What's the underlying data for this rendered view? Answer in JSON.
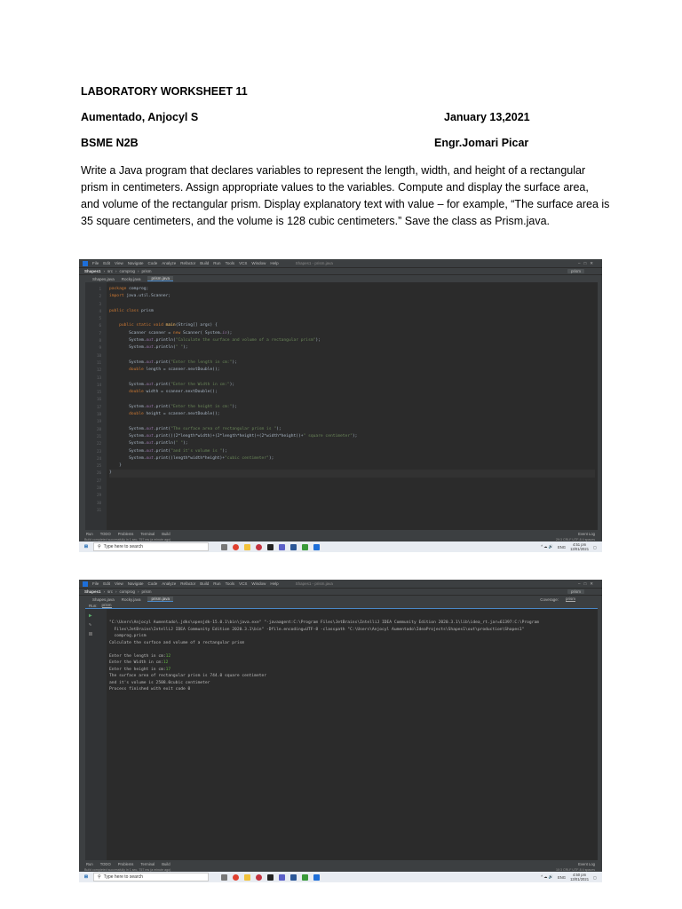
{
  "document": {
    "title": "LABORATORY WORKSHEET 11",
    "author": "Aumentado, Anjocyl S",
    "date": "January 13,2021",
    "section": "BSME N2B",
    "instructor": "Engr.Jomari Picar",
    "task": "Write a Java program that declares variables to represent the length, width, and height of a rectangular prism in centimeters. Assign appropriate values to the variables. Compute and display the surface area, and volume of the rectangular prism. Display explanatory text with value – for example, “The surface area is 35 square centimeters, and the volume is 128 cubic centimeters.” Save the class as Prism.java."
  },
  "ide": {
    "menu": [
      "File",
      "Edit",
      "View",
      "Navigate",
      "Code",
      "Analyze",
      "Refactor",
      "Build",
      "Run",
      "Tools",
      "VCS",
      "Window",
      "Help"
    ],
    "window_title": "Shapes1 - prism.java",
    "breadcrumb": [
      "Shapes1",
      "src",
      "comprog",
      "prism"
    ],
    "run_config": "prism",
    "tabs": [
      "Shapes.java",
      "Rocky.java",
      "prism.java"
    ],
    "bottom_tools": [
      "Run",
      "TODO",
      "Problems",
      "Terminal",
      "Build"
    ],
    "event_log": "Event Log",
    "status_message": "Build completed successfully in 1 sec, 757 ms (a minute ago)",
    "editor_position": "29:3  CRLF  UTF-8  4 spaces",
    "run_position": "10:3  CRLF  UTF-8  4 spaces",
    "run_tab_label": "Run:",
    "run_tab": "prism",
    "coverage_label": "Coverage:",
    "coverage_tab": "prism"
  },
  "code": {
    "line_numbers": "1\n2\n3\n4\n5\n6\n7\n8\n9\n10\n11\n12\n13\n14\n15\n16\n17\n18\n19\n20\n21\n22\n23\n24\n25\n26\n27\n28\n29\n30\n31",
    "l1": "package ",
    "l1b": "comprog;",
    "l2": "import ",
    "l2b": "java.util.Scanner;",
    "l4": "public class ",
    "l4b": "prism",
    "l6a": "    public static void ",
    "l6b": "main",
    "l6c": "(String[] args) {",
    "l7a": "        Scanner scanner = ",
    "l7b": "new ",
    "l7c": "Scanner( System.",
    "l7d": "in",
    "l7e": ");",
    "l8a": "        System.",
    "l8b": "out",
    "l8c": ".println(",
    "l8d": "\"Calculate the surface and volume of a rectangular prism\"",
    "l8e": ");",
    "l9d": "\" \"",
    "l11d": "\"Enter the length in cm:\"",
    "l12a": "        double ",
    "l12b": "length = scanner.nextDouble();",
    "l14d": "\"Enter the Width in cm:\"",
    "l15b": "width = scanner.nextDouble();",
    "l17d": "\"Enter the height in cm:\"",
    "l18b": "height = scanner.nextDouble();",
    "l20d": "\"The surface area of rectangular prism is \"",
    "l21c": ".print(((2*length*width)+(2*length*height)+(2*width*height))+",
    "l21d": "\" square centimeter\"",
    "l22d": "\" \"",
    "l23d": "\"and it's volume is \"",
    "l24c": ".print((length*width*height)+",
    "l24d": "\"cubic centimeter\"",
    "print": ".print(",
    "println": ".println(",
    "close_paren": ");",
    "close_brace_inner": "    }",
    "close_brace_outer": "}"
  },
  "console": {
    "command": "\"C:\\Users\\Anjocyl Aumentado\\.jdks\\openjdk-15.0.1\\bin\\java.exe\" \"-javaagent:C:\\Program Files\\JetBrains\\IntelliJ IDEA Community Edition 2020.3.1\\lib\\idea_rt.jar=61397:C:\\Program",
    "command2": "  Files\\JetBrains\\IntelliJ IDEA Community Edition 2020.3.1\\bin\" -Dfile.encoding=UTF-8 -classpath \"C:\\Users\\Anjocyl Aumentado\\IdeaProjects\\Shapes1\\out\\production\\Shapes1\"",
    "command3": "  comprog.prism",
    "out1": "Calculate the surface and volume of a rectangular prism",
    "prompt_length": "Enter the length in cm:",
    "input_length": "12",
    "prompt_width": "Enter the Width in cm:",
    "input_width": "12",
    "prompt_height": "Enter the height in cm:",
    "input_height": "17",
    "result_area": "The surface area of rectangular prism is 744.0 square centimeter",
    "result_volume": "and it's volume is 2508.0cubic centimeter",
    "finished": "Process finished with exit code 0"
  },
  "taskbar": {
    "search_placeholder": "Type here to search",
    "language": "ENG",
    "time_editor": "4:51 pm",
    "time_run": "4:50 pm",
    "date": "13/01/2021"
  },
  "colors": {
    "ide_bg": "#2b2b2b",
    "keyword": "#cc7832",
    "string": "#6a8759",
    "field": "#9876aa",
    "method": "#ffc66d",
    "console_input": "#62b543"
  }
}
